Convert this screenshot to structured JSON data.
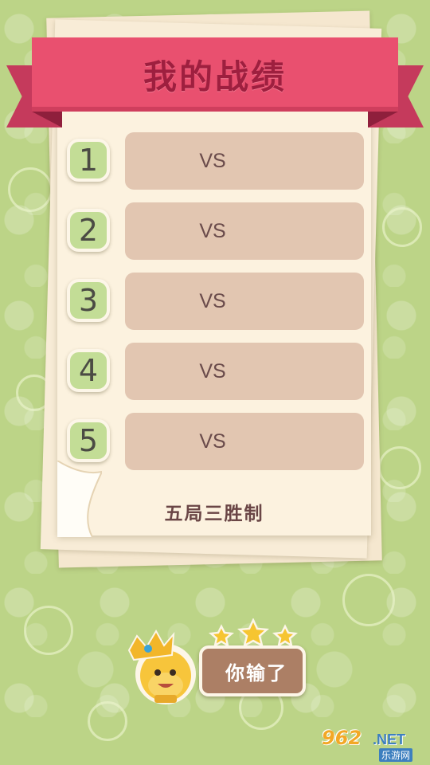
{
  "header": {
    "title": "我的战绩"
  },
  "rounds": [
    {
      "number": "1",
      "vs": "VS"
    },
    {
      "number": "2",
      "vs": "VS"
    },
    {
      "number": "3",
      "vs": "VS"
    },
    {
      "number": "4",
      "vs": "VS"
    },
    {
      "number": "5",
      "vs": "VS"
    }
  ],
  "rule": "五局三胜制",
  "result": {
    "text": "你输了",
    "stars_count": 3
  },
  "watermark": {
    "number": "962",
    "suffix": ".NET",
    "site": "乐游网"
  },
  "colors": {
    "background": "#bcd487",
    "ribbon": "#e9506f",
    "round_box": "#e2c6b1",
    "round_num": "#c3dd96",
    "result_plate": "#ac7f65",
    "star": "#f6c531"
  },
  "icons": {
    "avatar": "crowned-character-icon",
    "star": "star-icon"
  }
}
